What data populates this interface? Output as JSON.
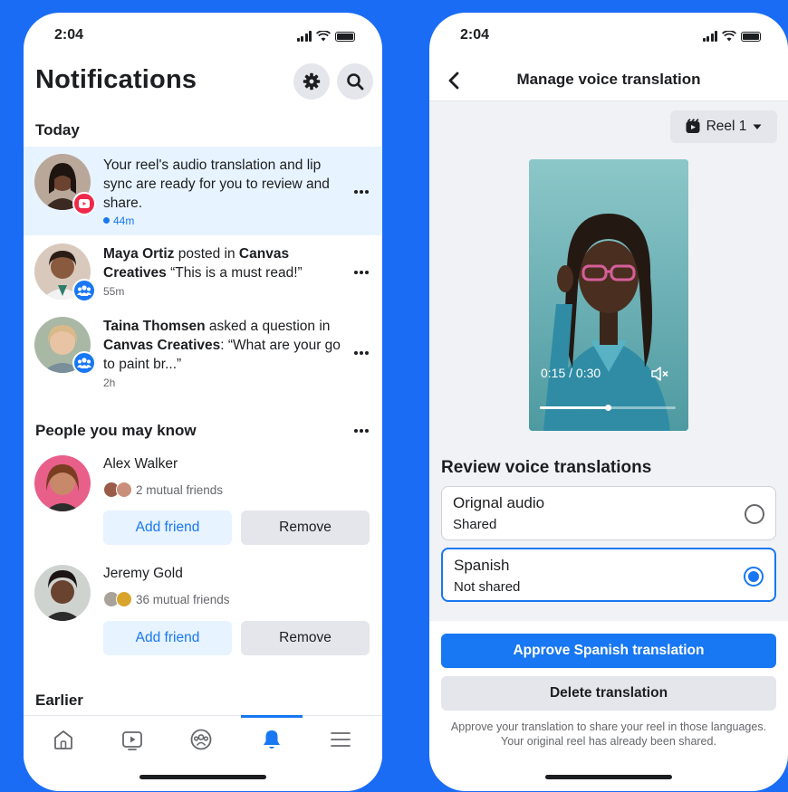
{
  "colors": {
    "background": "#1a6cf5",
    "accent": "#1877f2",
    "unread": "#e7f3ff",
    "badge_red": "#f02849"
  },
  "left": {
    "status_time": "2:04",
    "title": "Notifications",
    "today_label": "Today",
    "notifications": [
      {
        "text": "Your reel's audio translation and lip sync are ready for you to review and share.",
        "time": "44m",
        "badge_icon": "reel-icon"
      },
      {
        "actor": "Maya Ortiz",
        "mid": " posted in ",
        "target": "Canvas Creatives",
        "rest": " “This is a must read!”",
        "time": "55m",
        "badge_icon": "group-icon"
      },
      {
        "actor": "Taina Thomsen",
        "mid": " asked a question in ",
        "target": "Canvas Creatives",
        "rest": ": “What are your go to paint br...”",
        "time": "2h",
        "badge_icon": "group-icon"
      }
    ],
    "pymk_label": "People you may know",
    "people": [
      {
        "name": "Alex Walker",
        "mutual": "2 mutual friends",
        "add_label": "Add friend",
        "remove_label": "Remove"
      },
      {
        "name": "Jeremy Gold",
        "mutual": "36 mutual friends",
        "add_label": "Add friend",
        "remove_label": "Remove"
      }
    ],
    "earlier_label": "Earlier",
    "tabs": [
      "home-icon",
      "video-icon",
      "groups-icon",
      "bell-icon",
      "menu-icon"
    ],
    "active_tab": "bell-icon"
  },
  "right": {
    "status_time": "2:04",
    "nav_title": "Manage voice translation",
    "reel_selector": "Reel 1",
    "video_time": "0:15 / 0:30",
    "video_progress": 0.5,
    "review_title": "Review voice translations",
    "options": [
      {
        "label": "Orignal audio",
        "sub": "Shared",
        "selected": false
      },
      {
        "label": "Spanish",
        "sub": "Not shared",
        "selected": true
      }
    ],
    "approve_label": "Approve Spanish translation",
    "delete_label": "Delete translation",
    "footnote": "Approve your translation to share your reel in those languages. Your original reel has already been shared."
  }
}
